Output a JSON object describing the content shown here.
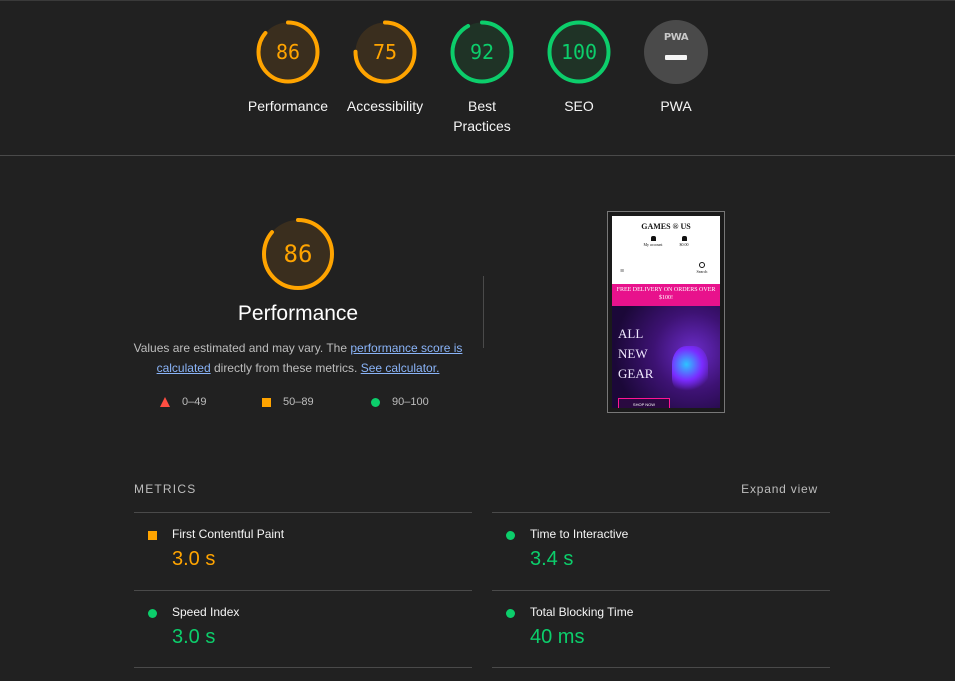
{
  "gauges": [
    {
      "score": "86",
      "label": "Performance",
      "fraction": 0.86,
      "color": "#ffa400"
    },
    {
      "score": "75",
      "label": "Accessibility",
      "fraction": 0.75,
      "color": "#ffa400"
    },
    {
      "score": "92",
      "label_line1": "Best",
      "label_line2": "Practices",
      "fraction": 0.92,
      "color": "#0cce6b"
    },
    {
      "score": "100",
      "label": "SEO",
      "fraction": 1.0,
      "color": "#0cce6b"
    },
    {
      "badge_text": "PWA",
      "label": "PWA"
    }
  ],
  "performance": {
    "score": "86",
    "title": "Performance",
    "desc_prefix": "Values are estimated and may vary. The ",
    "link1": "performance score is calculated",
    "desc_mid": " directly from these metrics. ",
    "link2": "See calculator.",
    "legend": [
      {
        "range": "0–49",
        "shape": "triangle",
        "color": "#ff4e42"
      },
      {
        "range": "50–89",
        "shape": "square",
        "color": "#ffa400"
      },
      {
        "range": "90–100",
        "shape": "circle",
        "color": "#0cce6b"
      }
    ]
  },
  "thumbnail": {
    "brand": "GAMES ® US",
    "account": "My account",
    "cart": "$0.00",
    "search": "Search",
    "banner": "FREE DELIVERY ON ORDERS OVER $100!",
    "hero_line1": "ALL",
    "hero_line2": "NEW",
    "hero_line3": "GEAR",
    "hero_button": "SHOP NOW"
  },
  "metrics": {
    "heading": "METRICS",
    "expand_label": "Expand view",
    "items": [
      {
        "label": "First Contentful Paint",
        "value": "3.0 s",
        "status": "average",
        "color": "#ffa400"
      },
      {
        "label": "Time to Interactive",
        "value": "3.4 s",
        "status": "pass",
        "color": "#0cce6b"
      },
      {
        "label": "Speed Index",
        "value": "3.0 s",
        "status": "pass",
        "color": "#0cce6b"
      },
      {
        "label": "Total Blocking Time",
        "value": "40 ms",
        "status": "pass",
        "color": "#0cce6b"
      }
    ]
  },
  "colors": {
    "background": "#212121",
    "orange": "#ffa400",
    "green": "#0cce6b",
    "red": "#ff4e42",
    "link": "#8ab4f8"
  }
}
